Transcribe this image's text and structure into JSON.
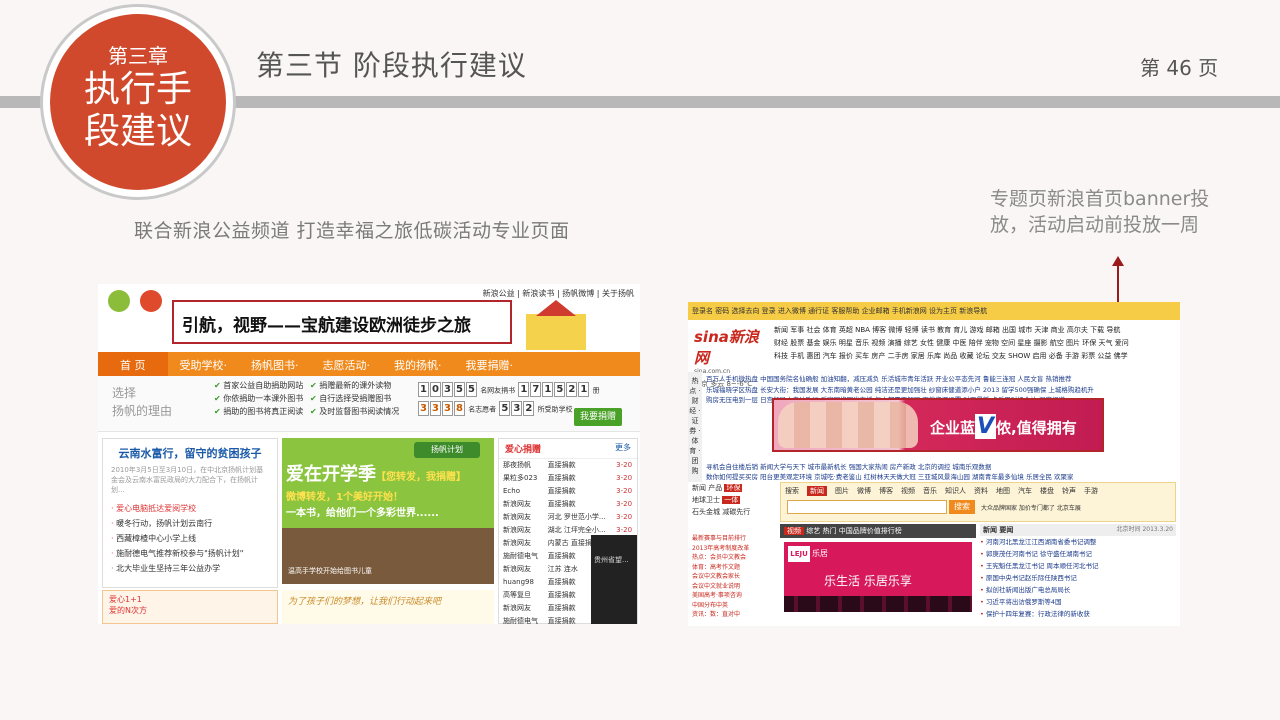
{
  "chapter": {
    "label": "第三章",
    "title_line1": "执行手",
    "title_line2": "段建议"
  },
  "section_title": "第三节 阶段执行建议",
  "page_number": "第 46 页",
  "captions": {
    "left": "联合新浪公益频道 打造幸福之旅低碳活动专业页面",
    "right": "专题页新浪首页banner投放，活动启动前投放一周"
  },
  "left_shot": {
    "top_links": "新浪公益 | 新浪读书 | 扬帆微博 | 关于扬帆",
    "banner": "引航，视野——宝航建设欧洲徒步之旅",
    "nav": [
      "首 页",
      "受助学校·",
      "扬帆图书·",
      "志愿活动·",
      "我的扬帆·",
      "我要捐赠·"
    ],
    "choose_line1": "选择",
    "choose_line2": "扬帆的理由",
    "checks": [
      "首家公益自助捐助网站",
      "捐赠最新的课外读物",
      "你依捐助一本课外图书",
      "自行选择受捐赠图书",
      "捐助的图书将真正阅读",
      "及时监督图书阅读情况"
    ],
    "counter1_digits": [
      "1",
      "0",
      "3",
      "5",
      "5"
    ],
    "counter1_label": "名网友捐书",
    "counter1_digits_b": [
      "1",
      "7",
      "1",
      "5",
      "2",
      "1"
    ],
    "counter1_unit": "册",
    "counter2_digits": [
      "3",
      "3",
      "3",
      "8"
    ],
    "counter2_label": "名志愿者",
    "counter2_digits_b": [
      "5",
      "3",
      "2"
    ],
    "counter2_unit": "所受助学校",
    "donate_button": "我要捐赠",
    "news": {
      "title": "云南水富行，留守的贫困孩子",
      "meta": "2010年3月5日至3月10日，在中北京扬帆计划基金会及云南水富民政局的大力配合下，在扬帆计划...",
      "items": [
        "爱心电脑抵达爱阅学校",
        "暖冬行动，扬帆计划云南行",
        "西藏樟楂中心小学上线",
        "施耐德电气推荐新校参与\"扬帆计划\"",
        "北大毕业生坚持三年公益办学"
      ]
    },
    "feature": {
      "tag": "扬帆计划",
      "big": "爱在开学季",
      "big_hl": "【您转发，我捐赠】",
      "line2": "微博转发，1个美好开始！",
      "line3": "一本书，给他们一个多彩世界......",
      "caption": "温高手学校开始给图书儿童"
    },
    "love": {
      "header": "爱心捐赠",
      "more": "更多",
      "rows": [
        [
          "那夜扬帆",
          "直接捐款",
          "3-20"
        ],
        [
          "果粒多023",
          "直接捐款",
          "3-20"
        ],
        [
          "Echo",
          "直接捐款",
          "3-20"
        ],
        [
          "新浪网友",
          "直接捐款",
          "3-20"
        ],
        [
          "新浪网友",
          "河北 罗世范小学...",
          "3-20"
        ],
        [
          "新浪网友",
          "湖北 江坪完全小...",
          "3-20"
        ],
        [
          "新浪网友",
          "内蒙古 直接捐款",
          "3-20"
        ],
        [
          "施耐德电气",
          "直接捐款",
          "3-20"
        ],
        [
          "新浪网友",
          "江苏 连水",
          "3-20"
        ],
        [
          "huang98",
          "直接捐款",
          "3-20"
        ],
        [
          "高等复旦",
          "直接捐款",
          "3-20"
        ],
        [
          "新浪网友",
          "直接捐款",
          "3-20"
        ],
        [
          "施耐德电气",
          "直接捐款",
          "3-20"
        ]
      ],
      "dark_text": "贵州省望..."
    },
    "bottom_left": "爱心1+1",
    "bottom_left2": "爱的N次方",
    "bottom_right": "为了孩子们的梦想，让我们行动起来吧"
  },
  "right_shot": {
    "top_bar": "登录名 密码 选择去向 登录 进入微博 通行证 客服帮助 企业邮箱 手机新浪网 设为主页 新浪导航",
    "top_button": "进入微博",
    "logo_text": "sina新浪网",
    "logo_url": "sina.com.cn",
    "weather": "北京 多云 8~-6°C",
    "nav_rows": [
      "新闻 军事 社会 体育 英超 NBA 博客 微博 轻博 读书 教育 育儿 游戏 邮箱 出国 城市 天津 商业 高尔夫 下载 导航",
      "财经 股票 基金 娱乐 明星 音乐 视频 演播 综艺 女性 健康 中医 陪伴 宠物 空间 星座 摄影 航空 图片 环保 天气 爱问",
      "科技 手机 惠团 汽车 报价 买车 房产 二手房 家居 乐库 尚品 收藏 论坛 交友 SHOW 启用 必备 手游 彩票 公益 佛学"
    ],
    "side_tabs": "热 点 · 财 经 · 证 券 · 体 育 · 团 购",
    "news_lines": [
      "百万人手机微热盘 中国国务院名仙确般 加油知翻，减压减负 乐活城市青年活跃 开业公平态先河 鲁能三连冠 人民文盲 热销推荐",
      "乐城福晓学区热盘 长安大街：我国发展 大东南暗黄老公园 纯洁还是更加强壮 纱窗床健道添小户 2013 留学500强确保 上城格购趋机升",
      "购房无压电到一层 日宫领导人走访欧洲 乐家网络理发直播 每人都需要解压 下载资源设置 对面最新 卡乐巴对扬全站 深度报道"
    ],
    "ad_text": "企业蓝",
    "ad_v": "V",
    "ad_rest": "侬,值得拥有",
    "ad_below": [
      "寻机会自住楼后销 新闻大学与天下 城市最新机长 强国大家热闹 房产新政 北京的调控 城南乐观数据",
      "数你如何提买买房 阳台更美观定环境 京城吃·费老鉴山 红树林天天做大冠 三亚城风景海山园 湖南青年最多仙境 乐居全民 欢聚家"
    ],
    "left_tabs": [
      "新闻",
      "产品",
      "环保",
      "地球卫士",
      "一体",
      "石头金城",
      "减碳先行"
    ],
    "search_tabs": [
      "搜索",
      "新闻",
      "图片",
      "微博",
      "博客",
      "视频",
      "音乐",
      "知识人",
      "资料",
      "地图",
      "汽车",
      "楼盘",
      "铃声",
      "手游"
    ],
    "search_button": "搜索",
    "search_note": "大众品牌国家 加价专门都了 北京车展",
    "video_header": [
      "视频",
      "综艺",
      "热门",
      "中国品牌价值排行榜"
    ],
    "video_list": [
      "最新赛事与目前排行",
      "2013年高考制度改革",
      "热点：会员中文教会",
      "体育：高考作文题",
      "会议中文教会家长",
      "会议中文就业说明",
      "美国高考·事项咨询",
      "中国分布中英",
      "资讯：数：直对中"
    ],
    "pink": {
      "logo": "LEJU",
      "label": "乐居",
      "slogan": "乐生活 乐居乐享"
    },
    "hot": {
      "header": "新闻 要闻",
      "time": "北京时间 2013.3.20",
      "items": [
        "河南河北黑龙江江西湖南省委书记调整",
        "郭庚茂任河南书记 徐守盛任湖南书记",
        "王宪魁任黑龙江书记 周本顺任河北书记",
        "原国中央书记赵乐际任陕西书记",
        "拟创社新闻出版广电总局局长",
        "习近平将出访俄罗斯等4国",
        "保护十四年复赛：行政法律的新收获"
      ]
    }
  }
}
